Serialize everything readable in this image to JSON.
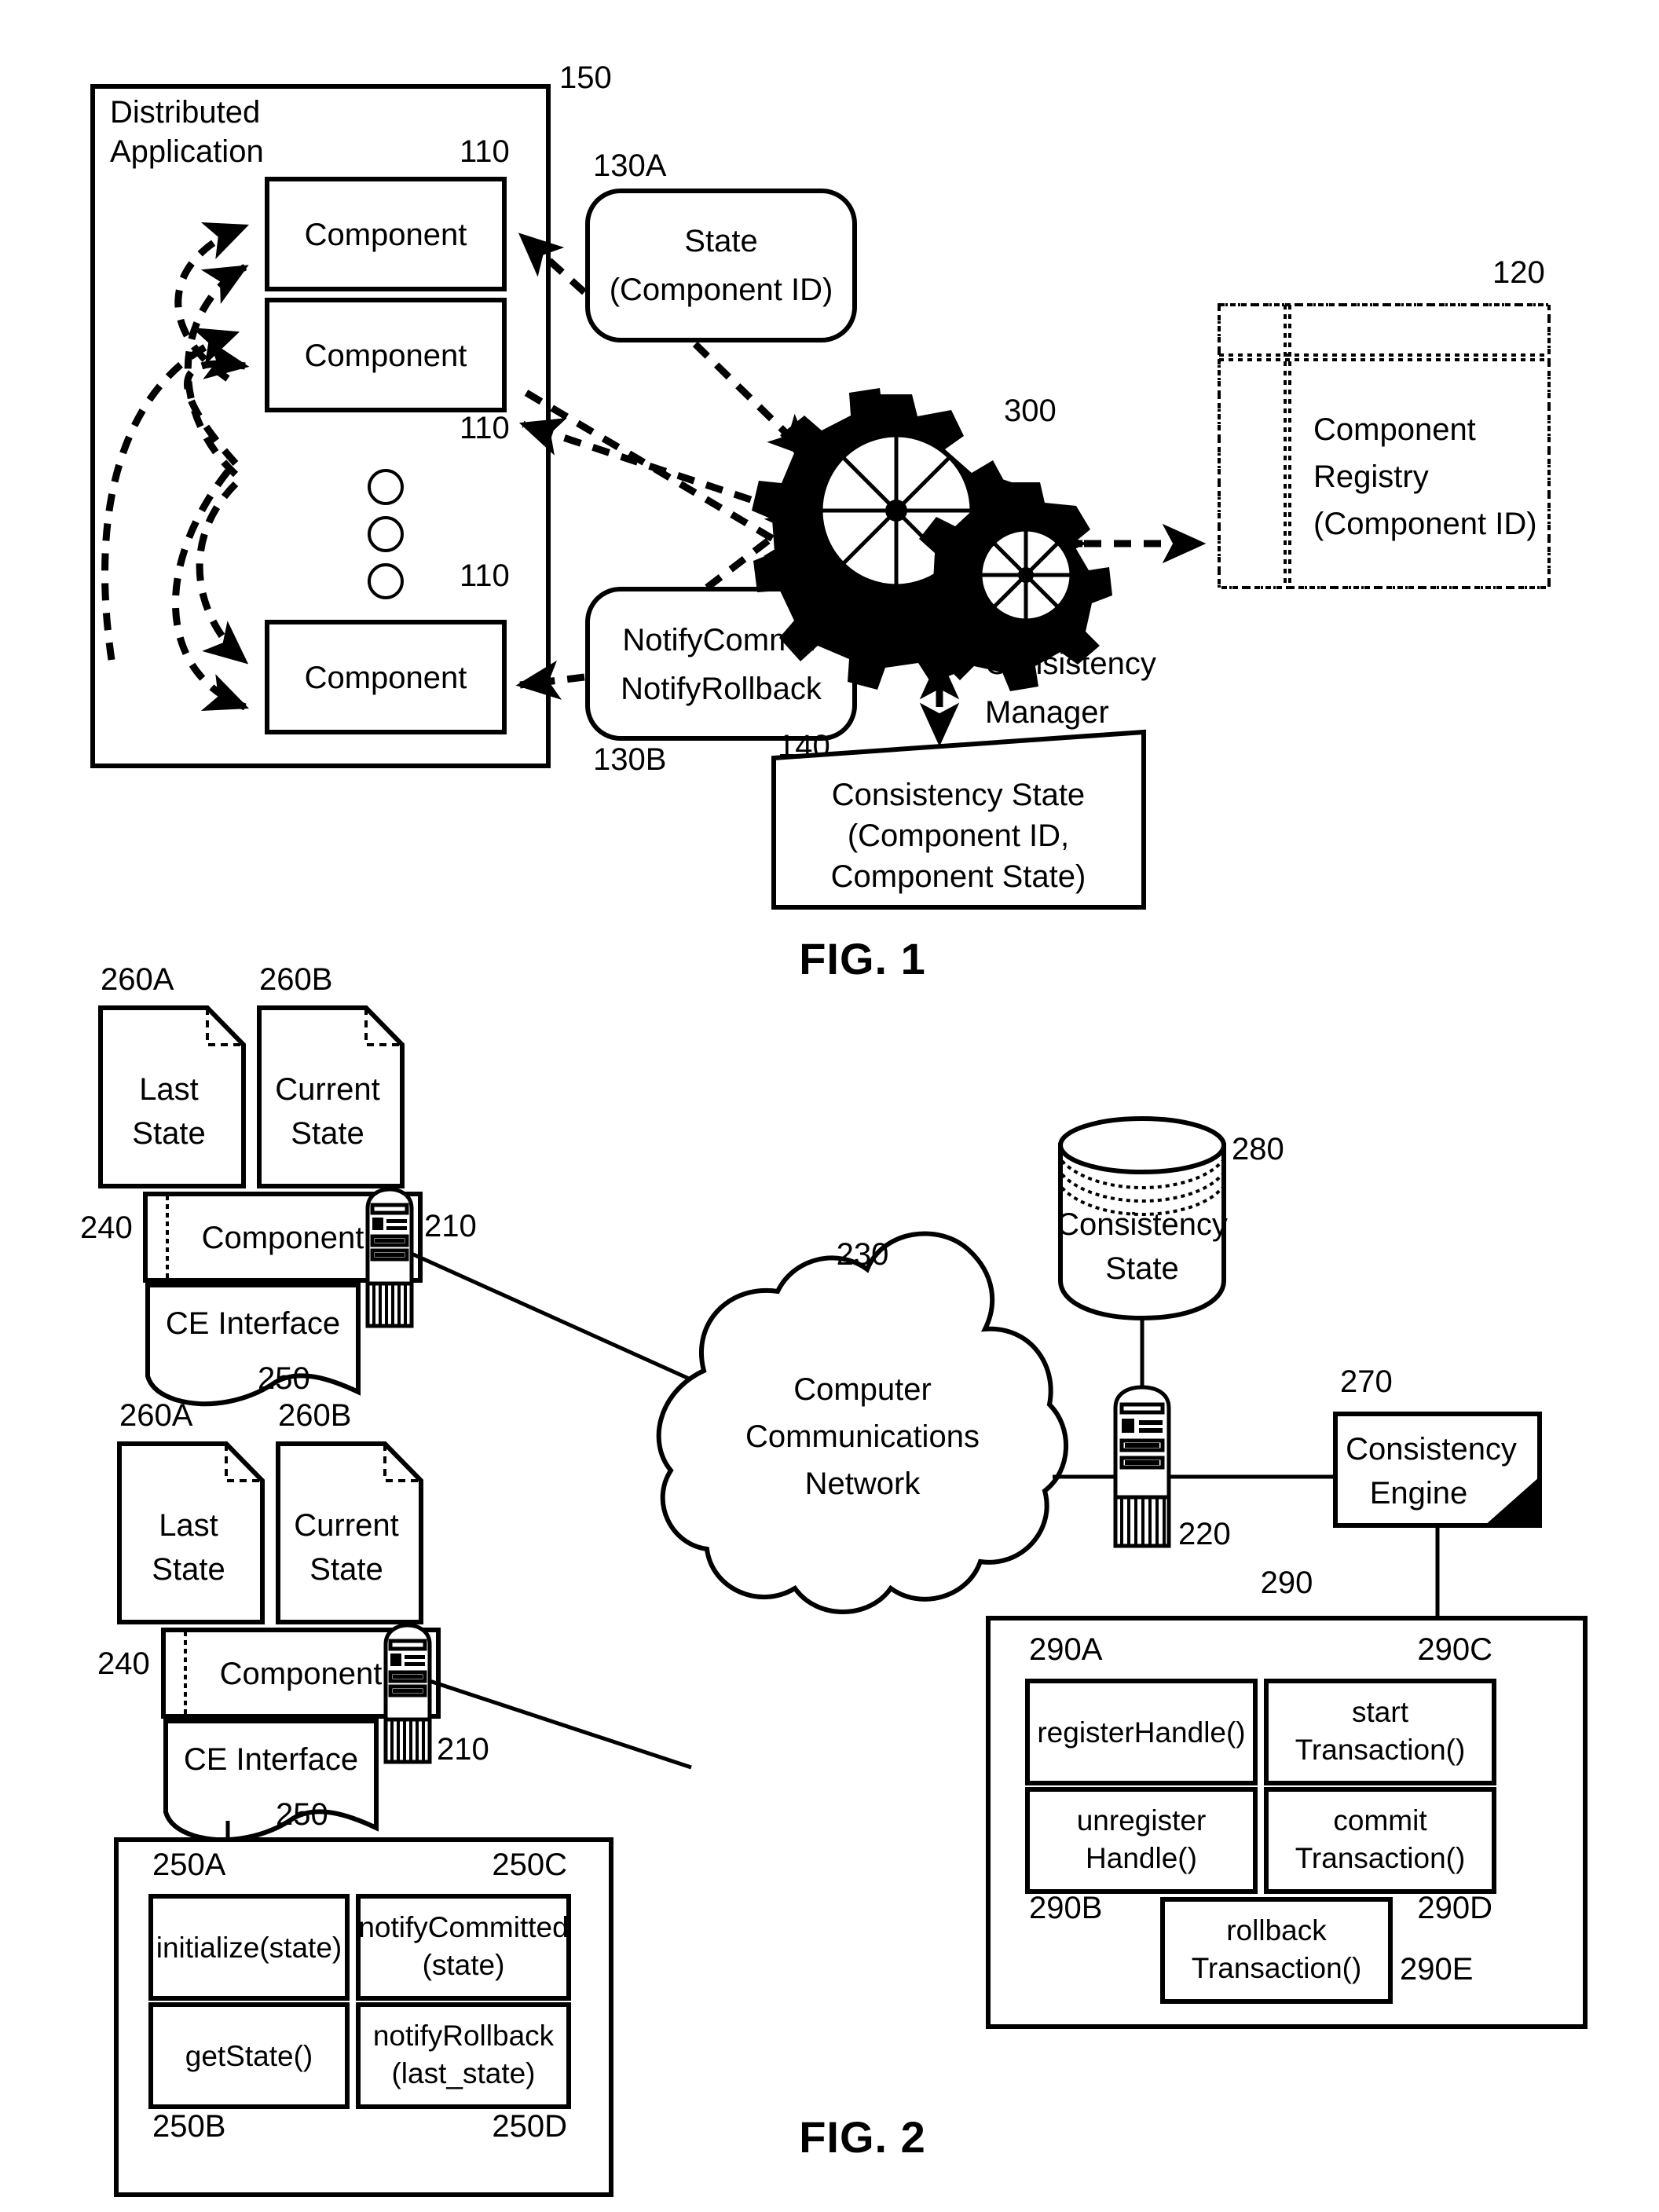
{
  "figure1": {
    "caption": "FIG. 1",
    "distributed_application": {
      "label": "Distributed\nApplication",
      "line1": "Distributed",
      "line2": "Application",
      "ref": "150"
    },
    "components": [
      {
        "label": "Component",
        "ref": "110"
      },
      {
        "label": "Component",
        "ref": "110"
      },
      {
        "label": "Component",
        "ref": "110"
      }
    ],
    "ellipsis": "three-vertical-circles",
    "state_message": {
      "line1": "State",
      "line2": "(Component ID)",
      "ref": "130A"
    },
    "notify_message": {
      "line1": "NotifyCommit/",
      "line2": "NotifyRollback",
      "ref": "130B"
    },
    "consistency_manager": {
      "line1": "Consistency",
      "line2": "Manager",
      "ref": "300"
    },
    "component_registry": {
      "line1": "Component",
      "line2": "Registry",
      "line3": "(Component ID)",
      "ref": "120"
    },
    "consistency_state": {
      "line1": "Consistency State",
      "line2": "(Component ID,",
      "line3": "Component State)",
      "ref": "140"
    }
  },
  "figure2": {
    "caption": "FIG. 2",
    "nodes": [
      {
        "last_state": {
          "line1": "Last",
          "line2": "State",
          "ref": "260A"
        },
        "current_state": {
          "line1": "Current",
          "line2": "State",
          "ref": "260B"
        },
        "component": {
          "label": "Component",
          "ref": "240"
        },
        "ce_interface": {
          "label": "CE Interface",
          "ref": "250"
        },
        "server": {
          "ref": "210"
        }
      },
      {
        "last_state": {
          "line1": "Last",
          "line2": "State",
          "ref": "260A"
        },
        "current_state": {
          "line1": "Current",
          "line2": "State",
          "ref": "260B"
        },
        "component": {
          "label": "Component",
          "ref": "240"
        },
        "ce_interface": {
          "label": "CE Interface",
          "ref": "250"
        },
        "server": {
          "ref": "210"
        }
      }
    ],
    "network": {
      "line1": "Computer",
      "line2": "Communications",
      "line3": "Network",
      "ref": "230"
    },
    "consistency_state_db": {
      "line1": "Consistency",
      "line2": "State",
      "ref": "280"
    },
    "server_center": {
      "ref": "220"
    },
    "consistency_engine": {
      "line1": "Consistency",
      "line2": "Engine",
      "ref": "270"
    },
    "ce_api": {
      "ref": "250",
      "methods": [
        {
          "line1": "initialize(state)",
          "line2": "",
          "ref": "250A",
          "ref_pos": "top-left"
        },
        {
          "line1": "notifyCommitted",
          "line2": "(state)",
          "ref": "250C",
          "ref_pos": "top-right"
        },
        {
          "line1": "getState()",
          "line2": "",
          "ref": "250B",
          "ref_pos": "bottom-left"
        },
        {
          "line1": "notifyRollback",
          "line2": "(last_state)",
          "ref": "250D",
          "ref_pos": "bottom-right"
        }
      ]
    },
    "engine_api": {
      "ref": "290",
      "methods": [
        {
          "line1": "registerHandle()",
          "line2": "",
          "ref": "290A",
          "ref_pos": "top-left"
        },
        {
          "line1": "start",
          "line2": "Transaction()",
          "ref": "290C",
          "ref_pos": "top-right"
        },
        {
          "line1": "unregister",
          "line2": "Handle()",
          "ref": "290B",
          "ref_pos": "bottom-left"
        },
        {
          "line1": "commit",
          "line2": "Transaction()",
          "ref": "290D",
          "ref_pos": "bottom-right"
        },
        {
          "line1": "rollback",
          "line2": "Transaction()",
          "ref": "290E",
          "ref_pos": "center-bottom"
        }
      ]
    }
  }
}
